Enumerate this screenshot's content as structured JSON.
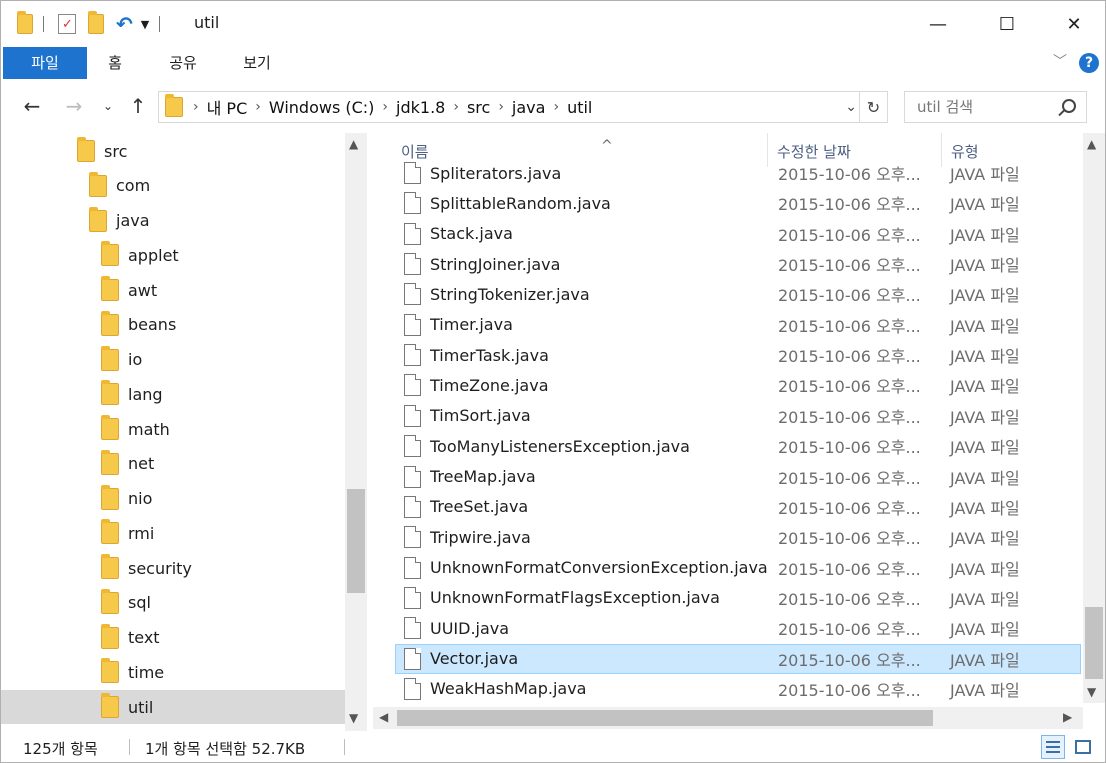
{
  "title": "util",
  "ribbon": {
    "tabs": [
      "파일",
      "홈",
      "공유",
      "보기"
    ],
    "help": "?"
  },
  "window_controls": {
    "minimize": "—",
    "maximize": "☐",
    "close": "✕"
  },
  "address": {
    "crumbs": [
      "내 PC",
      "Windows (C:)",
      "jdk1.8",
      "src",
      "java",
      "util"
    ],
    "search_placeholder": "util 검색"
  },
  "tree": [
    {
      "label": "src",
      "level": 0
    },
    {
      "label": "com",
      "level": 1
    },
    {
      "label": "java",
      "level": 1
    },
    {
      "label": "applet",
      "level": 2
    },
    {
      "label": "awt",
      "level": 2
    },
    {
      "label": "beans",
      "level": 2
    },
    {
      "label": "io",
      "level": 2
    },
    {
      "label": "lang",
      "level": 2
    },
    {
      "label": "math",
      "level": 2
    },
    {
      "label": "net",
      "level": 2
    },
    {
      "label": "nio",
      "level": 2
    },
    {
      "label": "rmi",
      "level": 2
    },
    {
      "label": "security",
      "level": 2
    },
    {
      "label": "sql",
      "level": 2
    },
    {
      "label": "text",
      "level": 2
    },
    {
      "label": "time",
      "level": 2
    },
    {
      "label": "util",
      "level": 2,
      "selected": true
    }
  ],
  "columns": {
    "name": "이름",
    "date": "수정한 날짜",
    "type": "유형"
  },
  "files": [
    {
      "name": "Spliterators.java",
      "date": "2015-10-06 오후...",
      "type": "JAVA 파일"
    },
    {
      "name": "SplittableRandom.java",
      "date": "2015-10-06 오후...",
      "type": "JAVA 파일"
    },
    {
      "name": "Stack.java",
      "date": "2015-10-06 오후...",
      "type": "JAVA 파일"
    },
    {
      "name": "StringJoiner.java",
      "date": "2015-10-06 오후...",
      "type": "JAVA 파일"
    },
    {
      "name": "StringTokenizer.java",
      "date": "2015-10-06 오후...",
      "type": "JAVA 파일"
    },
    {
      "name": "Timer.java",
      "date": "2015-10-06 오후...",
      "type": "JAVA 파일"
    },
    {
      "name": "TimerTask.java",
      "date": "2015-10-06 오후...",
      "type": "JAVA 파일"
    },
    {
      "name": "TimeZone.java",
      "date": "2015-10-06 오후...",
      "type": "JAVA 파일"
    },
    {
      "name": "TimSort.java",
      "date": "2015-10-06 오후...",
      "type": "JAVA 파일"
    },
    {
      "name": "TooManyListenersException.java",
      "date": "2015-10-06 오후...",
      "type": "JAVA 파일"
    },
    {
      "name": "TreeMap.java",
      "date": "2015-10-06 오후...",
      "type": "JAVA 파일"
    },
    {
      "name": "TreeSet.java",
      "date": "2015-10-06 오후...",
      "type": "JAVA 파일"
    },
    {
      "name": "Tripwire.java",
      "date": "2015-10-06 오후...",
      "type": "JAVA 파일"
    },
    {
      "name": "UnknownFormatConversionException.java",
      "date": "2015-10-06 오후...",
      "type": "JAVA 파일"
    },
    {
      "name": "UnknownFormatFlagsException.java",
      "date": "2015-10-06 오후...",
      "type": "JAVA 파일"
    },
    {
      "name": "UUID.java",
      "date": "2015-10-06 오후...",
      "type": "JAVA 파일"
    },
    {
      "name": "Vector.java",
      "date": "2015-10-06 오후...",
      "type": "JAVA 파일",
      "selected": true
    },
    {
      "name": "WeakHashMap.java",
      "date": "2015-10-06 오후...",
      "type": "JAVA 파일"
    }
  ],
  "status": {
    "item_count": "125개 항목",
    "selection": "1개 항목 선택함 52.7KB"
  }
}
